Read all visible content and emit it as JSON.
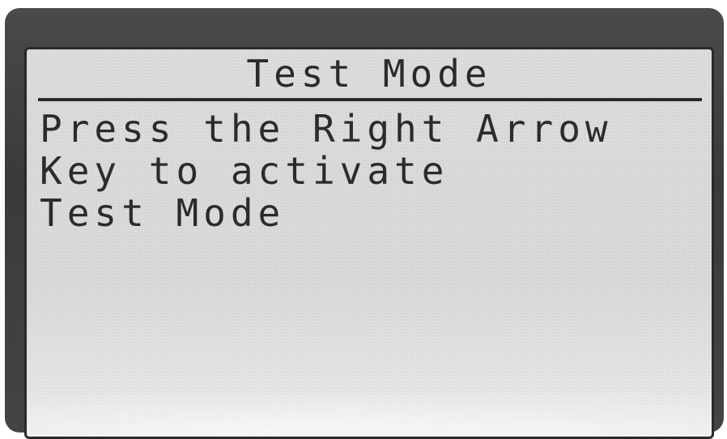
{
  "screen": {
    "title": "Test Mode",
    "lines": [
      "Press the Right Arrow",
      "Key to activate",
      "Test Mode"
    ]
  },
  "colors": {
    "bezel": "#3a3a3a",
    "lcd_background": "#dcdcdc",
    "lcd_text": "#2b2b2b"
  }
}
